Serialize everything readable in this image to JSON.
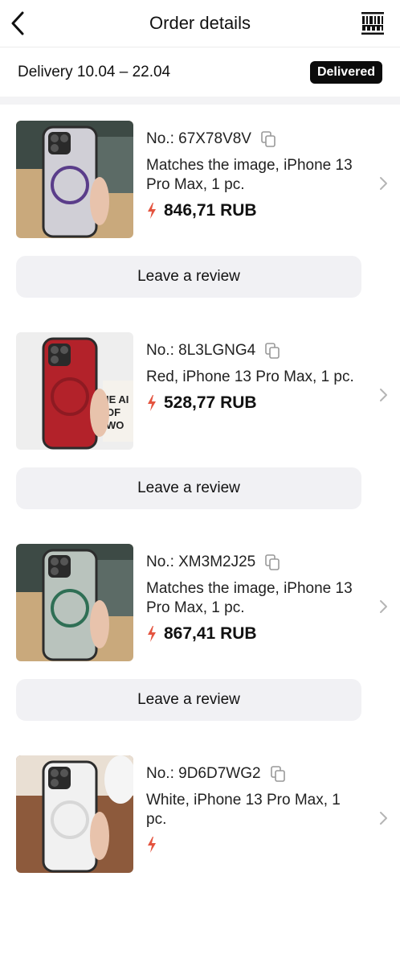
{
  "header": {
    "title": "Order details",
    "back_icon": "chevron-left-icon",
    "barcode_icon": "barcode-icon"
  },
  "delivery": {
    "text": "Delivery 10.04 – 22.04",
    "status": "Delivered"
  },
  "items": [
    {
      "order_no": "No.: 67X78V8V",
      "description": "Matches the image, iPhone 13 Pro Max, 1 pc.",
      "price": "846,71 RUB",
      "review_label": "Leave a review",
      "case_color": "#d0cfd6",
      "ring_color": "#5a3d8a",
      "bg": "#c9a97c"
    },
    {
      "order_no": "No.: 8L3LGNG4",
      "description": "Red, iPhone 13 Pro Max, 1 pc.",
      "price": "528,77 RUB",
      "review_label": "Leave a review",
      "case_color": "#b3222a",
      "ring_color": "#8e1a22",
      "bg": "#eeeeee"
    },
    {
      "order_no": "No.: XM3M2J25",
      "description": "Matches the image, iPhone 13 Pro Max, 1 pc.",
      "price": "867,41 RUB",
      "review_label": "Leave a review",
      "case_color": "#b9c3bd",
      "ring_color": "#2f6f55",
      "bg": "#c9a97c"
    },
    {
      "order_no": "No.: 9D6D7WG2",
      "description": "White, iPhone 13 Pro Max, 1 pc.",
      "price": "",
      "review_label": "",
      "case_color": "#f1f1f1",
      "ring_color": "#d7d7d7",
      "bg": "#8d5a3c"
    }
  ],
  "colors": {
    "accent_price": "#e4543f",
    "badge_bg": "#0b0b0b",
    "button_bg": "#f1f1f4"
  }
}
